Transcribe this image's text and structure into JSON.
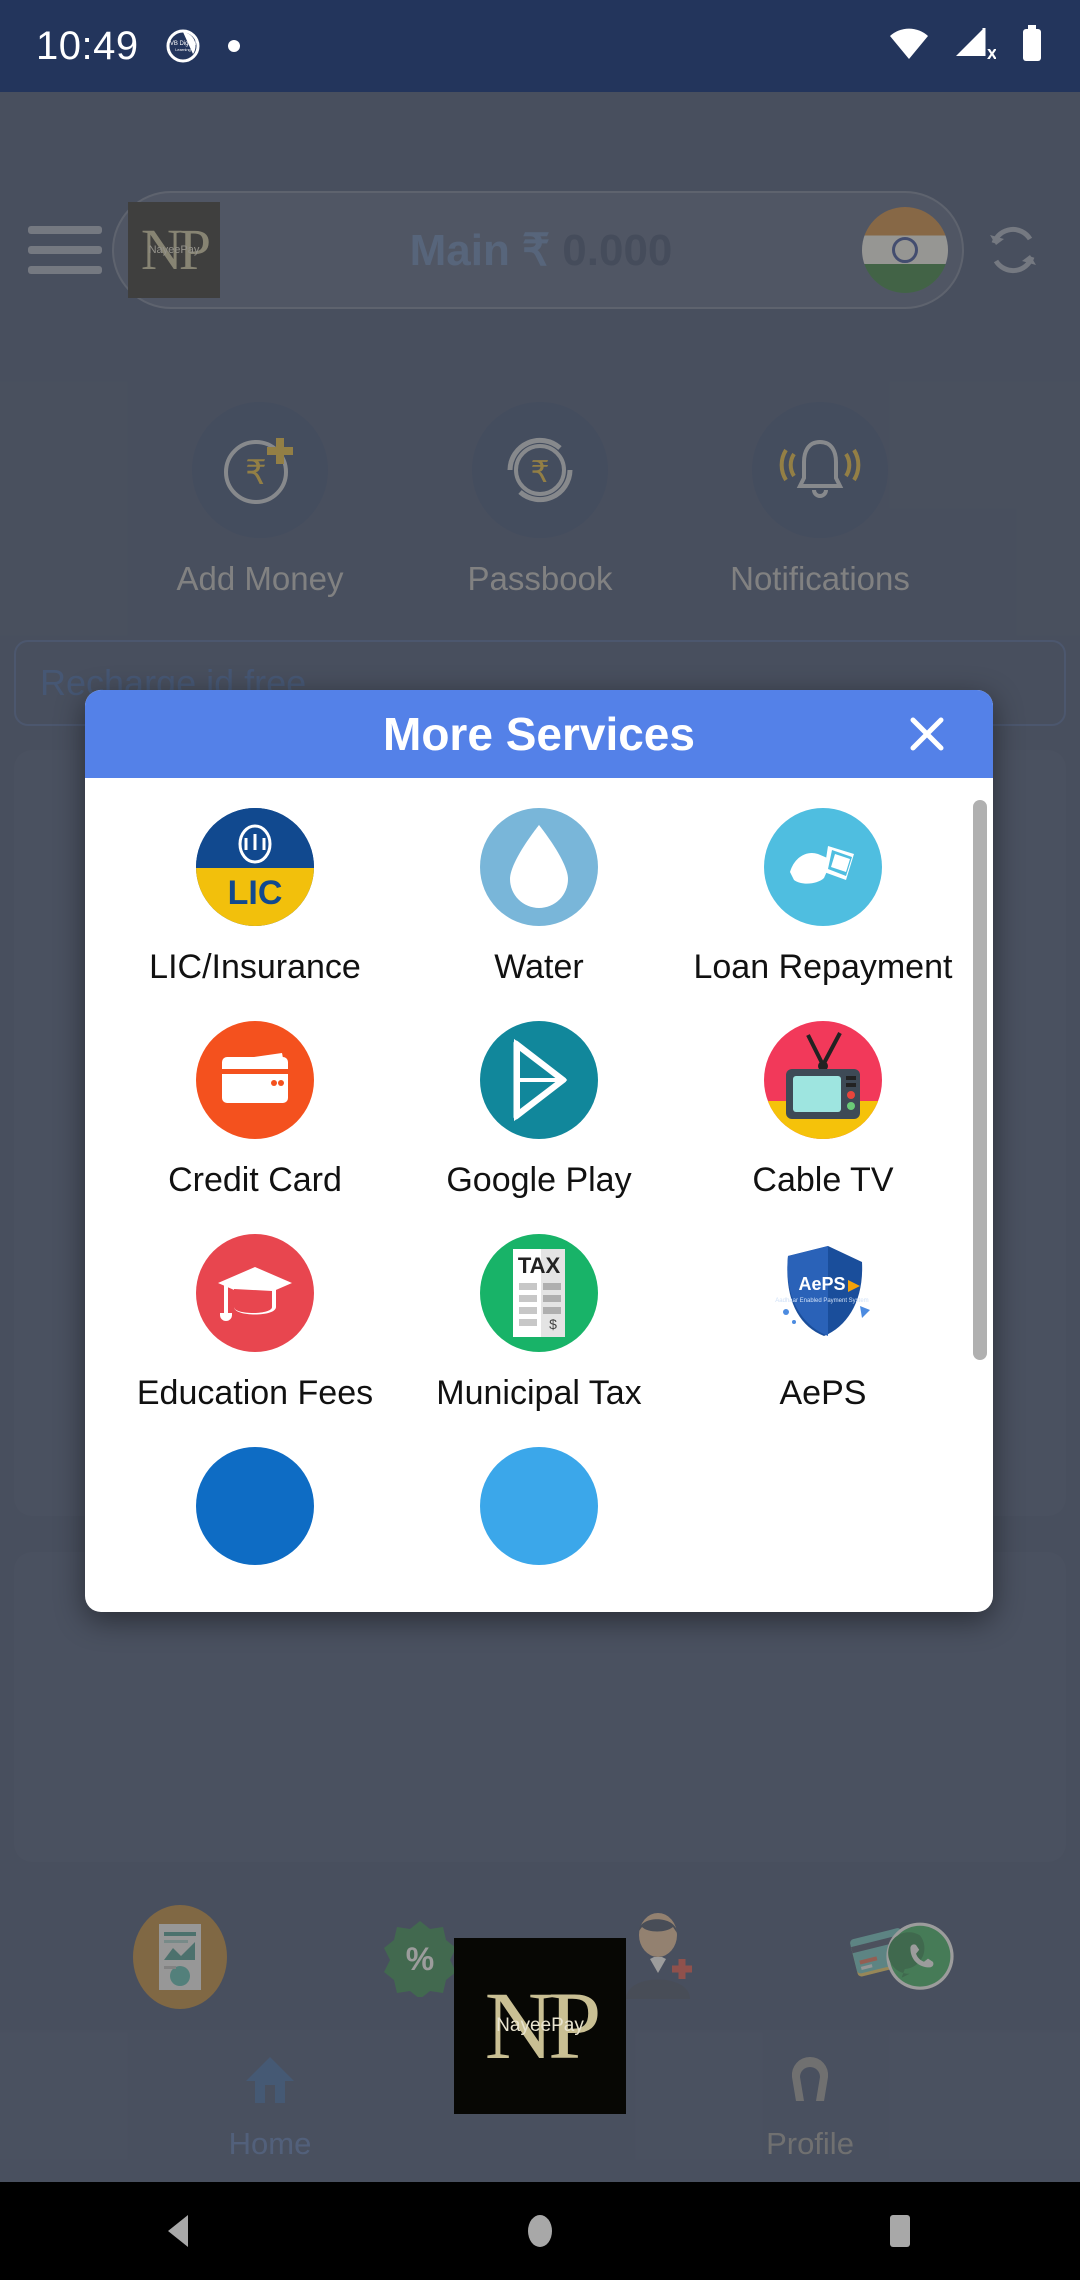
{
  "status_bar": {
    "time": "10:49",
    "notification_icon": "vb-digital-notification-icon",
    "dot_icon": "dot-icon",
    "wifi_icon": "wifi-icon",
    "signal_icon": "cellular-no-sim-icon",
    "battery_icon": "battery-full-icon"
  },
  "header": {
    "menu_icon": "hamburger-menu-icon",
    "logo_mark": "NP",
    "logo_sub": "NayeePay",
    "balance_label": "Main ₹",
    "balance_amount": "0.000",
    "flag_icon": "india-flag-icon",
    "refresh_icon": "refresh-icon"
  },
  "quick_actions": [
    {
      "label": "Add Money",
      "icon": "add-money-icon"
    },
    {
      "label": "Passbook",
      "icon": "passbook-icon"
    },
    {
      "label": "Notifications",
      "icon": "notification-bell-icon"
    }
  ],
  "recharge_banner": {
    "text": "Recharge id free"
  },
  "background_services": {
    "row1_colors": [
      "#C4761C",
      "#C4483C",
      "#D9B81C",
      "#14796B"
    ],
    "row2_colors": [
      "#C4761C",
      "#C4483C",
      "#D9B81C",
      "#14796B"
    ]
  },
  "modal": {
    "title": "More Services",
    "close_icon": "close-icon",
    "scrollbar": "vertical-scrollbar",
    "services": [
      {
        "label": "LIC/Insurance",
        "icon": "lic-insurance-icon",
        "color": "#11498F"
      },
      {
        "label": "Water",
        "icon": "water-drop-icon",
        "color": "#79B6D9"
      },
      {
        "label": "Loan Repayment",
        "icon": "loan-repayment-icon",
        "color": "#4FBEE0"
      },
      {
        "label": "Credit Card",
        "icon": "credit-card-icon",
        "color": "#F4511E"
      },
      {
        "label": "Google Play",
        "icon": "google-play-icon",
        "color": "#11879B"
      },
      {
        "label": "Cable TV",
        "icon": "cable-tv-icon",
        "color": "#F2395A"
      },
      {
        "label": "Education Fees",
        "icon": "education-fees-icon",
        "color": "#E8464F"
      },
      {
        "label": "Municipal Tax",
        "icon": "municipal-tax-icon",
        "color": "#18B368"
      },
      {
        "label": "AePS",
        "icon": "aeps-icon",
        "color": "#1A4E9B"
      }
    ],
    "partial_row": [
      {
        "icon": "partial-service-icon-blue",
        "color": "#0E6CC4"
      },
      {
        "icon": "partial-service-icon-lightblue",
        "color": "#3BA7EA"
      }
    ]
  },
  "bottom_icons": [
    {
      "icon": "reports-icon"
    },
    {
      "icon": "offers-percent-icon"
    },
    {
      "icon": "add-user-icon"
    },
    {
      "icon": "card-whatsapp-icon"
    }
  ],
  "bottom_nav": {
    "home_label": "Home",
    "home_icon": "home-icon",
    "profile_label": "Profile",
    "profile_icon": "profile-icon",
    "fab_mark": "NP",
    "fab_sub": "NayeePay"
  },
  "android_nav": {
    "back_icon": "back-triangle-icon",
    "home_icon": "home-circle-icon",
    "recents_icon": "recents-square-icon"
  },
  "colors": {
    "app_background": "#23355C",
    "modal_header": "#5481E8",
    "nav_bar": "#27395F",
    "accent_blue": "#1e4b96"
  }
}
